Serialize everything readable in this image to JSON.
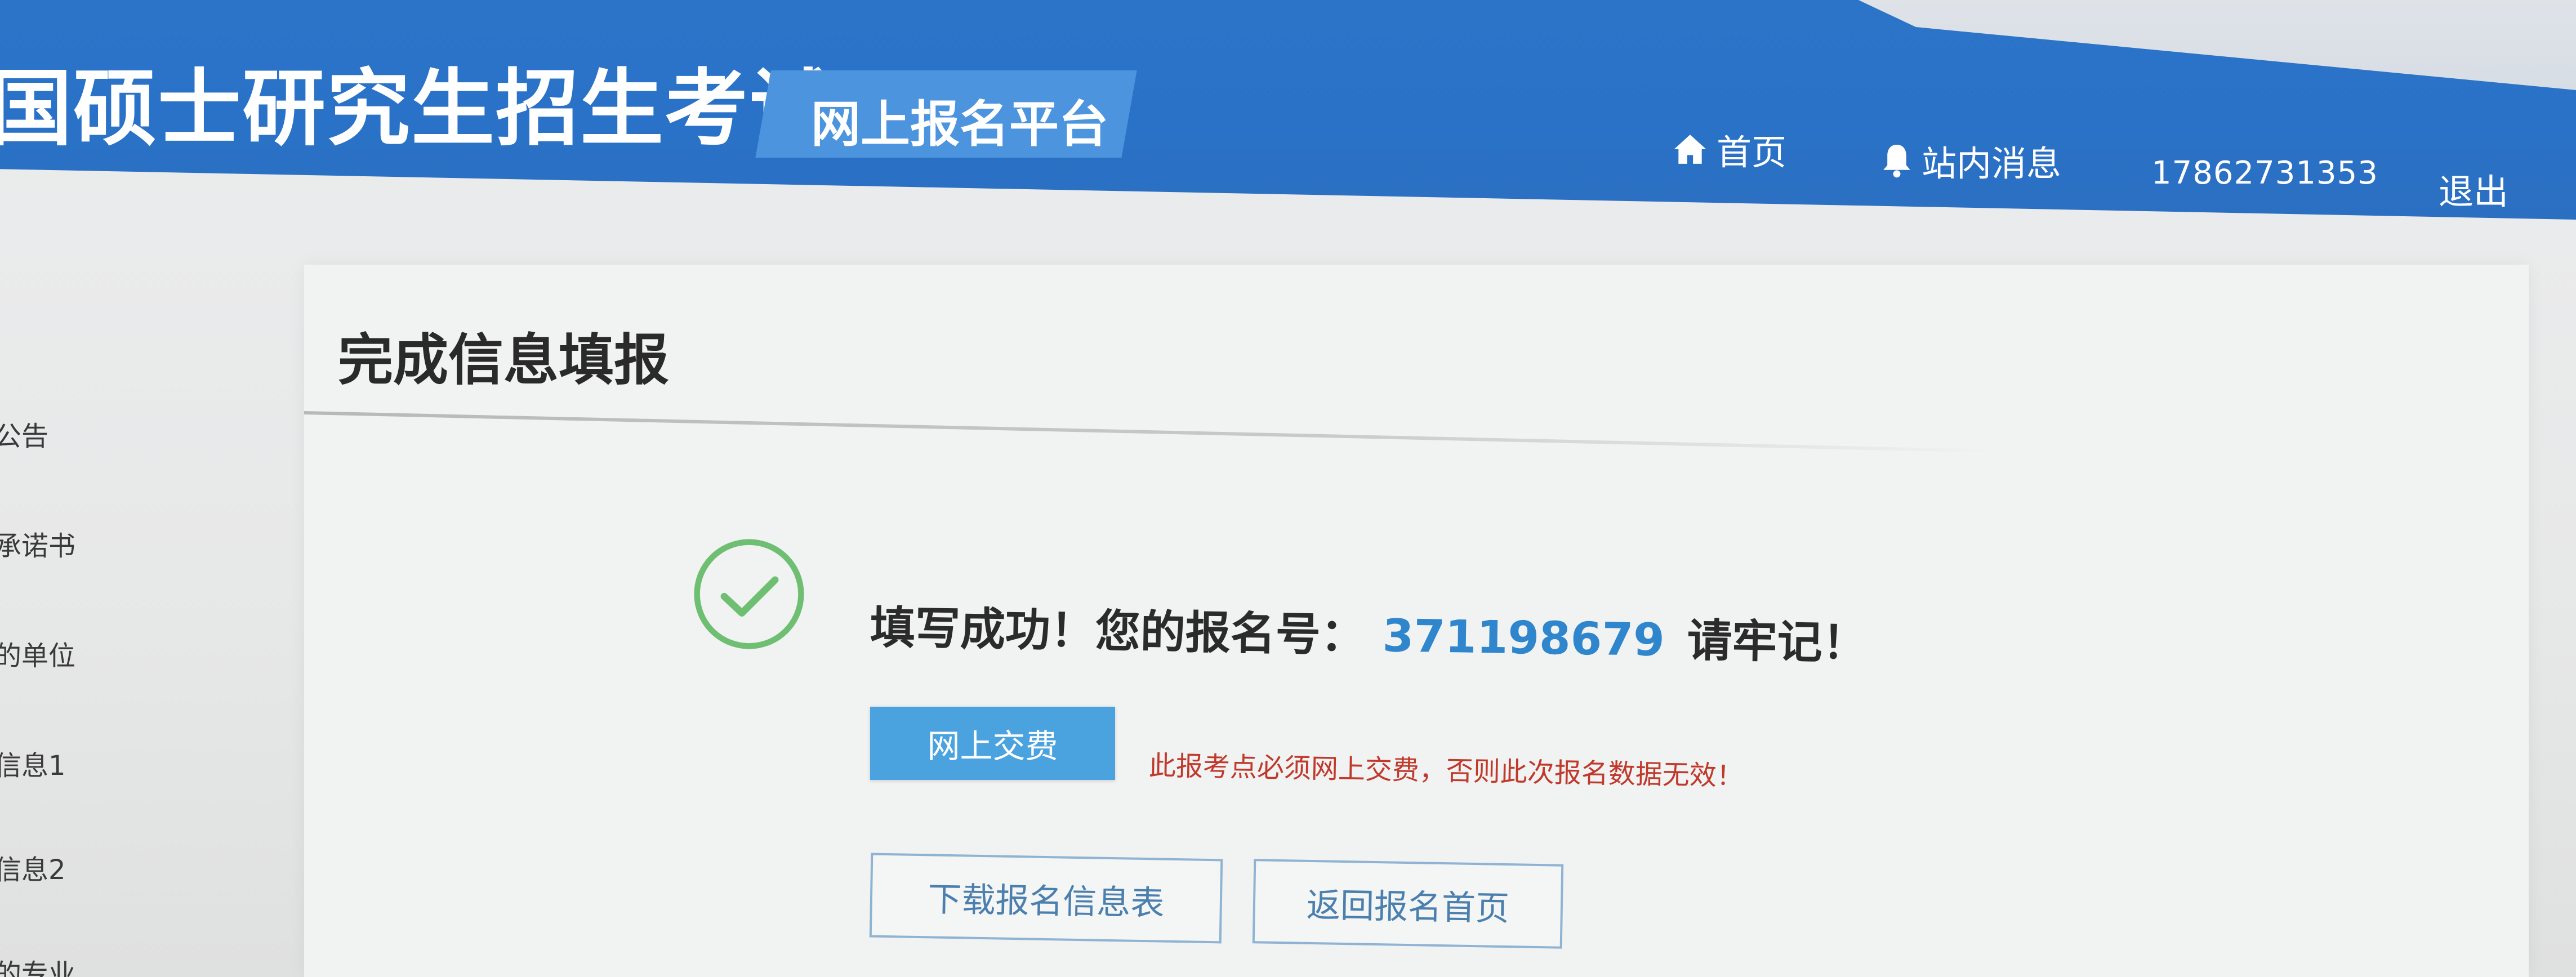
{
  "header": {
    "site_title": "国硕士研究生招生考试",
    "platform_label": "网上报名平台",
    "nav": {
      "home": {
        "label": "首页",
        "icon": "home-icon"
      },
      "messages": {
        "label": "站内消息",
        "icon": "bell-icon"
      },
      "user_phone": "17862731353",
      "logout": "退出"
    },
    "colors": {
      "bar": "#2b74c8",
      "badge": "#4c94de"
    }
  },
  "sidebar": {
    "items": [
      {
        "label": "公告"
      },
      {
        "label": "承诺书"
      },
      {
        "label": "的单位"
      },
      {
        "label": "信息1"
      },
      {
        "label": "信息2"
      },
      {
        "label": "的专业"
      }
    ]
  },
  "main": {
    "title": "完成信息填报",
    "success": {
      "icon": "check-circle-icon",
      "prefix": "填写成功！您的报名号：",
      "registration_number": "371198679",
      "suffix": "请牢记！"
    },
    "pay": {
      "button_label": "网上交费",
      "warning": "此报考点必须网上交费，否则此次报名数据无效！"
    },
    "actions": {
      "download_label": "下载报名信息表",
      "back_home_label": "返回报名首页"
    },
    "colors": {
      "accent": "#2f86cc",
      "pay_button": "#4aa3df",
      "warning": "#c0392b",
      "success_icon": "#5cb85c"
    }
  }
}
